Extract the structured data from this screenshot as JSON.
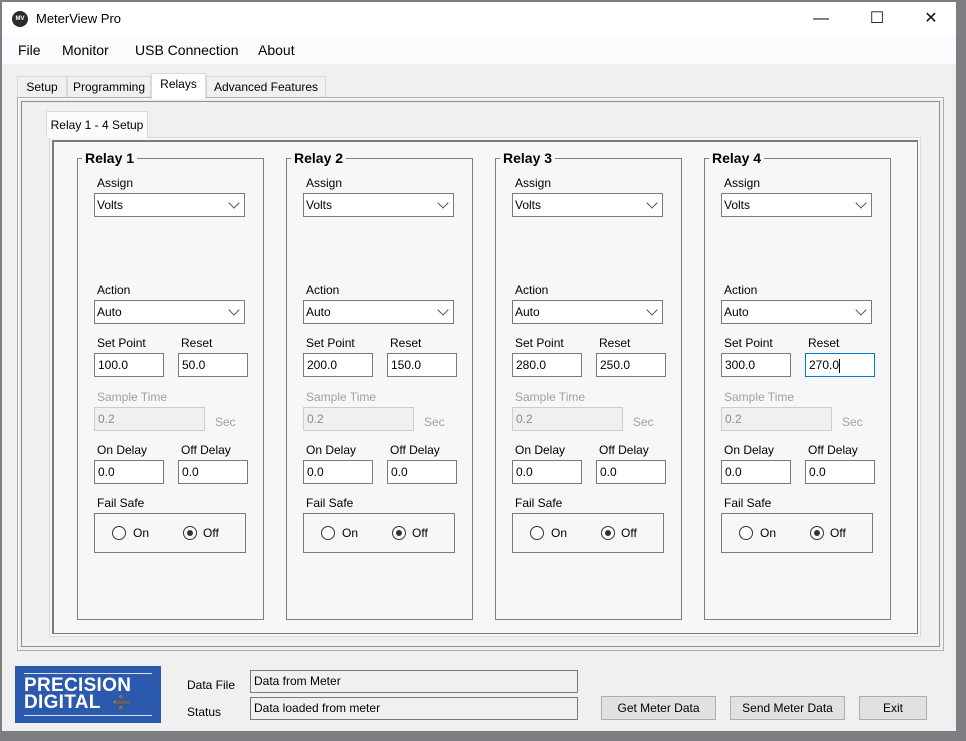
{
  "window": {
    "title": "MeterView Pro",
    "app_icon_glyph": "MV",
    "controls": {
      "minimize": "—",
      "maximize": "☐",
      "close": "✕"
    }
  },
  "menu": [
    "File",
    "Monitor",
    "USB Connection",
    "About"
  ],
  "tabs": [
    {
      "label": "Setup",
      "active": false
    },
    {
      "label": "Programming",
      "active": false
    },
    {
      "label": "Relays",
      "active": true
    },
    {
      "label": "Advanced Features",
      "active": false
    }
  ],
  "subtab": {
    "label": "Relay 1 - 4 Setup"
  },
  "labels": {
    "assign": "Assign",
    "action": "Action",
    "set_point": "Set Point",
    "reset": "Reset",
    "sample_time": "Sample Time",
    "sec": "Sec",
    "on_delay": "On Delay",
    "off_delay": "Off Delay",
    "fail_safe": "Fail Safe",
    "on": "On",
    "off": "Off"
  },
  "relays": [
    {
      "title": "Relay 1",
      "assign": "Volts",
      "action": "Auto",
      "set_point": "100.0",
      "reset": "50.0",
      "sample_time": "0.2",
      "on_delay": "0.0",
      "off_delay": "0.0",
      "fail_safe": "Off"
    },
    {
      "title": "Relay 2",
      "assign": "Volts",
      "action": "Auto",
      "set_point": "200.0",
      "reset": "150.0",
      "sample_time": "0.2",
      "on_delay": "0.0",
      "off_delay": "0.0",
      "fail_safe": "Off"
    },
    {
      "title": "Relay 3",
      "assign": "Volts",
      "action": "Auto",
      "set_point": "280.0",
      "reset": "250.0",
      "sample_time": "0.2",
      "on_delay": "0.0",
      "off_delay": "0.0",
      "fail_safe": "Off"
    },
    {
      "title": "Relay 4",
      "assign": "Volts",
      "action": "Auto",
      "set_point": "300.0",
      "reset": "270.0",
      "sample_time": "0.2",
      "on_delay": "0.0",
      "off_delay": "0.0",
      "fail_safe": "Off"
    }
  ],
  "focused_field": "relay4.reset",
  "footer": {
    "logo_line1": "PRECISION",
    "logo_line2": "DIGITAL",
    "logo_mark": "➗",
    "data_file_label": "Data File",
    "data_file_value": "Data from Meter",
    "status_label": "Status",
    "status_value": "Data loaded from meter",
    "buttons": {
      "get": "Get Meter Data",
      "send": "Send Meter Data",
      "exit": "Exit"
    }
  },
  "colors": {
    "logo_blue": "#2b59ad",
    "focus_blue": "#0078d7",
    "window_bg": "#f0f0f0"
  }
}
